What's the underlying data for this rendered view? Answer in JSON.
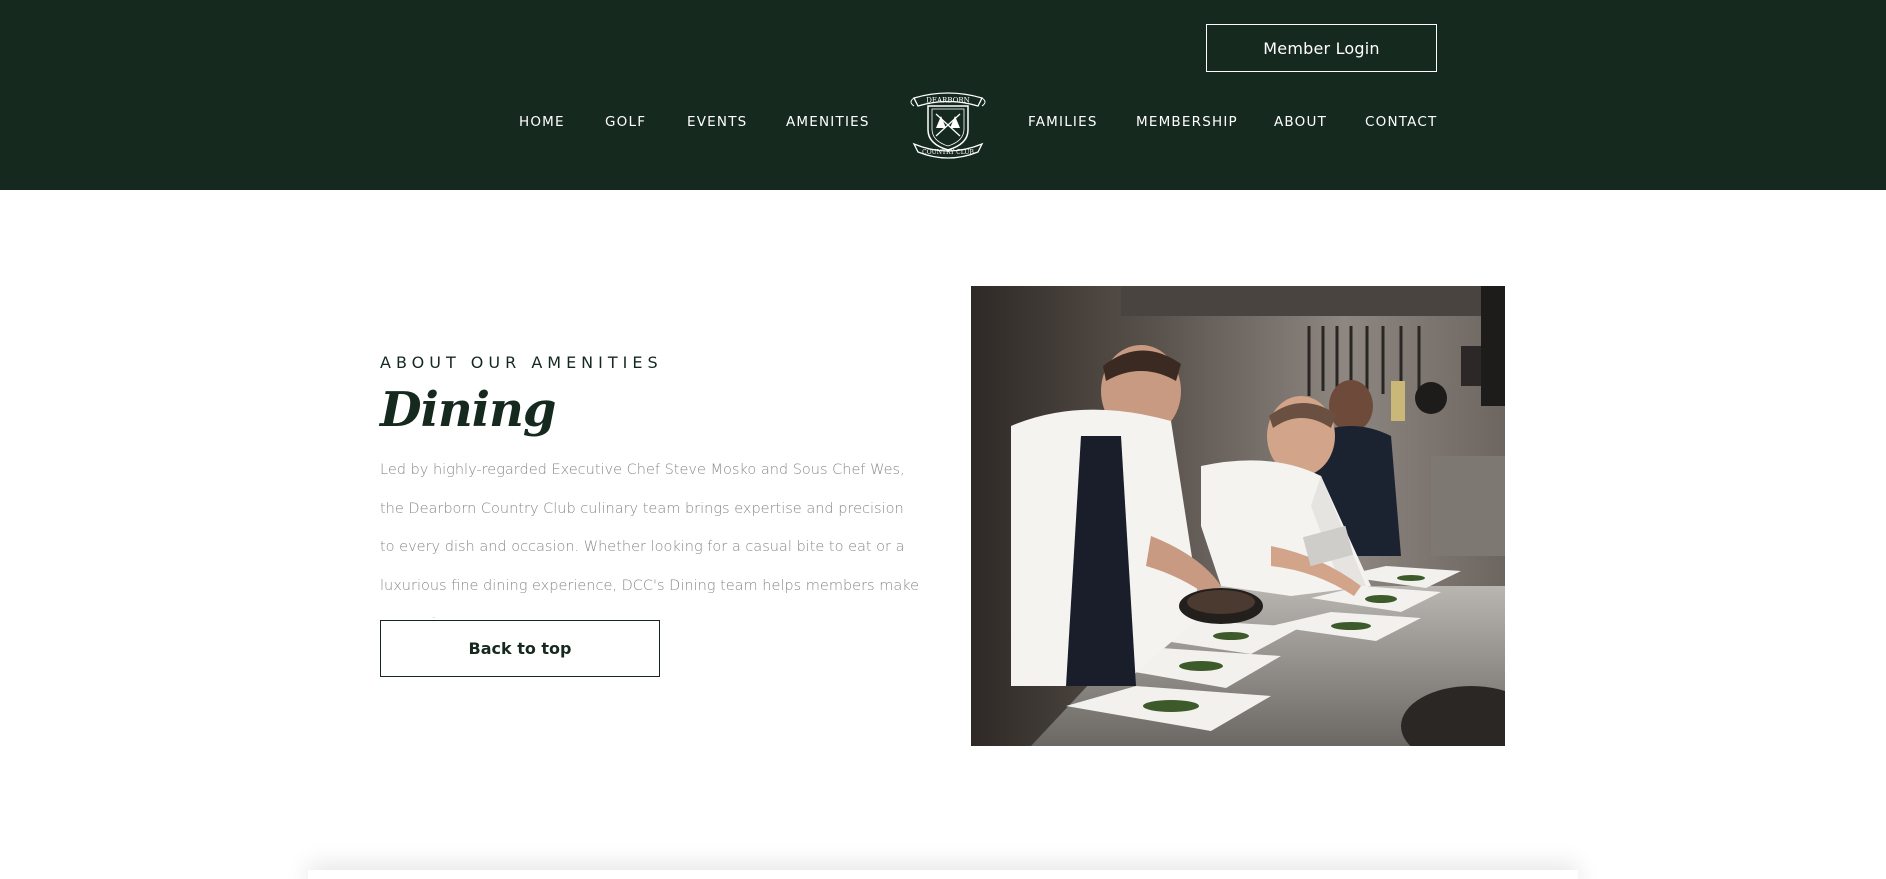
{
  "header": {
    "member_login_label": "Member Login",
    "nav": {
      "home": "HOME",
      "golf": "GOLF",
      "events": "EVENTS",
      "amenities": "AMENITIES",
      "families": "FAMILIES",
      "membership": "MEMBERSHIP",
      "about": "ABOUT",
      "contact": "CONTACT"
    },
    "logo": {
      "top_text": "DEARBORN",
      "bottom_text": "COUNTRY CLUB",
      "icon": "crest-logo-icon"
    },
    "background_color": "#15291f"
  },
  "main": {
    "eyebrow": "ABOUT OUR AMENITIES",
    "title": "Dining",
    "body": "Led by highly-regarded Executive Chef Steve Mosko and Sous Chef Wes, the Dearborn Country Club culinary team brings expertise and precision to every dish and occasion. Whether looking for a casual bite to eat or a luxurious fine dining experience, DCC's Dining team helps members make memories.",
    "back_to_top_label": "Back to top",
    "photo": {
      "icon": "chefs-plating-photo"
    }
  },
  "colors": {
    "brand_green": "#15291f",
    "body_text": "#8a8a8a"
  }
}
